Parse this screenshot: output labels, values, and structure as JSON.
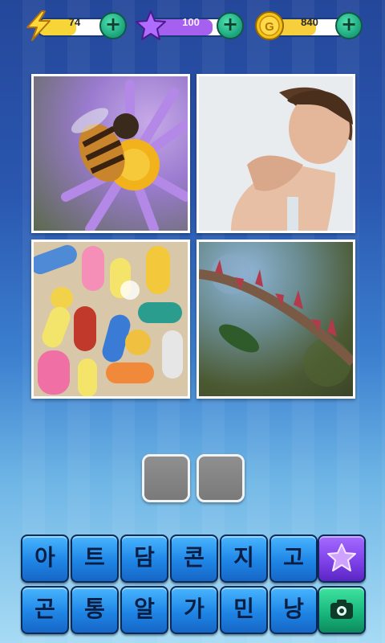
{
  "resources": {
    "energy": {
      "value": "74",
      "fill_fraction": 0.55,
      "icon": "lightning-icon",
      "color": "#f7d437"
    },
    "stars": {
      "value": "100",
      "fill_fraction": 0.8,
      "icon": "star-icon",
      "color": "#a560f0"
    },
    "coins": {
      "value": "840",
      "fill_fraction": 0.6,
      "icon": "coin-icon",
      "coin_letter": "G",
      "color": "#f7cf3d"
    }
  },
  "clue_images": [
    {
      "name": "bee-on-flower-image"
    },
    {
      "name": "neck-pain-image"
    },
    {
      "name": "pills-image"
    },
    {
      "name": "thorny-branch-image"
    }
  ],
  "answer": {
    "slots": 2
  },
  "keyboard": {
    "row1": [
      "아",
      "트",
      "담",
      "콘",
      "지",
      "고"
    ],
    "row2": [
      "곤",
      "통",
      "알",
      "가",
      "민",
      "낭"
    ],
    "power_icon": "star-powerup-icon",
    "camera_icon": "camera-icon"
  }
}
